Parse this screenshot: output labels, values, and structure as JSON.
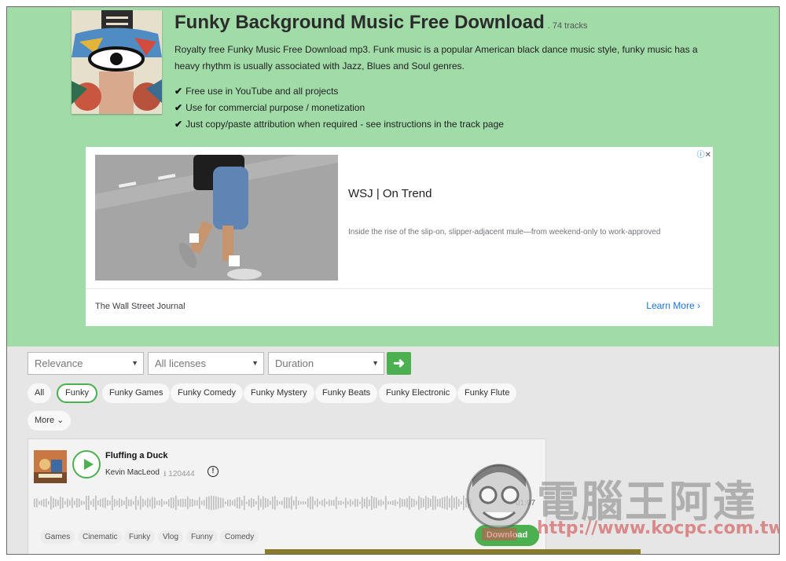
{
  "header": {
    "title": "Funky Background Music Free Download",
    "track_count": ". 74 tracks",
    "description": "Royalty free Funky Music Free Download mp3. Funk music is a popular American black dance music style, funky music has a heavy rhythm is usually associated with Jazz, Blues and Soul genres.",
    "features": [
      "Free use in YouTube and all projects",
      "Use for commercial purpose / monetization",
      "Just copy/paste attribution when required - see instructions in the track page"
    ]
  },
  "ad": {
    "headline": "WSJ | On Trend",
    "text": "Inside the rise of the slip-on, slipper-adjacent mule—from weekend-only to work-approved",
    "source": "The Wall Street Journal",
    "cta": "Learn More"
  },
  "filters": {
    "sort": "Relevance",
    "license": "All licenses",
    "duration": "Duration"
  },
  "chips": [
    "All",
    "Funky",
    "Funky Games",
    "Funky Comedy",
    "Funky Mystery",
    "Funky Beats",
    "Funky Electronic",
    "Funky Flute",
    "More"
  ],
  "active_chip": "Funky",
  "track": {
    "title": "Fluffing a Duck",
    "artist": "Kevin MacLeod",
    "downloads": "120444",
    "duration": "01:07",
    "tags": [
      "Games",
      "Cinematic",
      "Funky",
      "Vlog",
      "Funny",
      "Comedy"
    ],
    "download_label": "Download"
  },
  "watermark": {
    "text": "電腦王阿達",
    "url": "http://www.kocpc.com.tw"
  },
  "colors": {
    "hero_bg": "#a0dba8",
    "accent": "#4caf50",
    "page_bg": "#e6e6e6"
  }
}
